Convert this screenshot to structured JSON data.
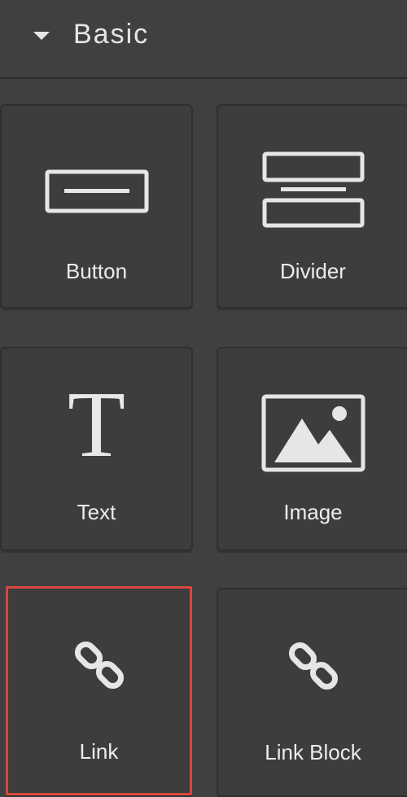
{
  "section": {
    "title": "Basic",
    "expanded": true,
    "caret_icon": "caret-down-icon"
  },
  "tiles": [
    {
      "label": "Button",
      "icon": "button-icon",
      "selected": false
    },
    {
      "label": "Divider",
      "icon": "divider-icon",
      "selected": false
    },
    {
      "label": "Text",
      "icon": "text-icon",
      "icon_glyph": "T",
      "selected": false
    },
    {
      "label": "Image",
      "icon": "image-icon",
      "selected": false
    },
    {
      "label": "Link",
      "icon": "link-icon",
      "selected": true
    },
    {
      "label": "Link Block",
      "icon": "link-block-icon",
      "selected": false
    }
  ],
  "colors": {
    "background": "#404040",
    "tile": "#3d3d3d",
    "icon": "#e6e6e6",
    "selection": "#d9473f"
  }
}
